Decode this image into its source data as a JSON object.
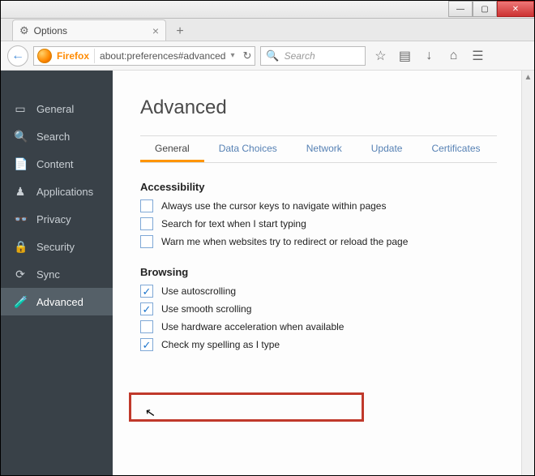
{
  "window": {
    "tab_title": "Options",
    "url_identity": "Firefox",
    "url": "about:preferences#advanced",
    "search_placeholder": "Search"
  },
  "sidebar": {
    "items": [
      {
        "icon": "▭",
        "label": "General"
      },
      {
        "icon": "🔍",
        "label": "Search"
      },
      {
        "icon": "📄",
        "label": "Content"
      },
      {
        "icon": "♟",
        "label": "Applications"
      },
      {
        "icon": "👓",
        "label": "Privacy"
      },
      {
        "icon": "🔒",
        "label": "Security"
      },
      {
        "icon": "⟳",
        "label": "Sync"
      },
      {
        "icon": "🧪",
        "label": "Advanced"
      }
    ],
    "active_index": 7
  },
  "page": {
    "title": "Advanced",
    "subtabs": [
      "General",
      "Data Choices",
      "Network",
      "Update",
      "Certificates"
    ],
    "active_subtab": 0,
    "sections": {
      "accessibility": {
        "title": "Accessibility",
        "options": [
          {
            "checked": false,
            "label": "Always use the cursor keys to navigate within pages"
          },
          {
            "checked": false,
            "label": "Search for text when I start typing"
          },
          {
            "checked": false,
            "label": "Warn me when websites try to redirect or reload the page"
          }
        ]
      },
      "browsing": {
        "title": "Browsing",
        "options": [
          {
            "checked": true,
            "label": "Use autoscrolling"
          },
          {
            "checked": true,
            "label": "Use smooth scrolling"
          },
          {
            "checked": false,
            "label": "Use hardware acceleration when available"
          },
          {
            "checked": true,
            "label": "Check my spelling as I type"
          }
        ]
      }
    }
  }
}
